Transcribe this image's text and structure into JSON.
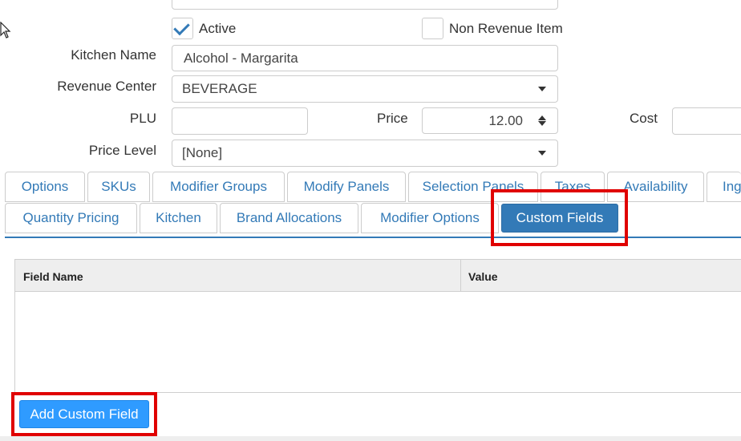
{
  "form": {
    "active_label": "Active",
    "active_checked": true,
    "non_revenue_label": "Non Revenue Item",
    "non_revenue_checked": false,
    "kitchen_name_label": "Kitchen Name",
    "kitchen_name_value": "Alcohol - Margarita",
    "revenue_center_label": "Revenue Center",
    "revenue_center_value": "BEVERAGE",
    "plu_label": "PLU",
    "plu_value": "",
    "price_label": "Price",
    "price_value": "12.00",
    "cost_label": "Cost",
    "cost_value": "",
    "price_level_label": "Price Level",
    "price_level_value": "[None]"
  },
  "tabs_row1": [
    {
      "label": "Options"
    },
    {
      "label": "SKUs"
    },
    {
      "label": "Modifier Groups"
    },
    {
      "label": "Modify Panels"
    },
    {
      "label": "Selection Panels"
    },
    {
      "label": "Taxes"
    },
    {
      "label": "Availability"
    },
    {
      "label": "Ing"
    }
  ],
  "tabs_row2": [
    {
      "label": "Quantity Pricing"
    },
    {
      "label": "Kitchen"
    },
    {
      "label": "Brand Allocations"
    },
    {
      "label": "Modifier Options"
    },
    {
      "label": "Custom Fields"
    }
  ],
  "active_tab": "Custom Fields",
  "table": {
    "headers": [
      "Field Name",
      "Value"
    ]
  },
  "add_button_label": "Add Custom Field",
  "colors": {
    "accent": "#337ab7",
    "highlight": "#e00000",
    "primary_button": "#2f9bff"
  }
}
